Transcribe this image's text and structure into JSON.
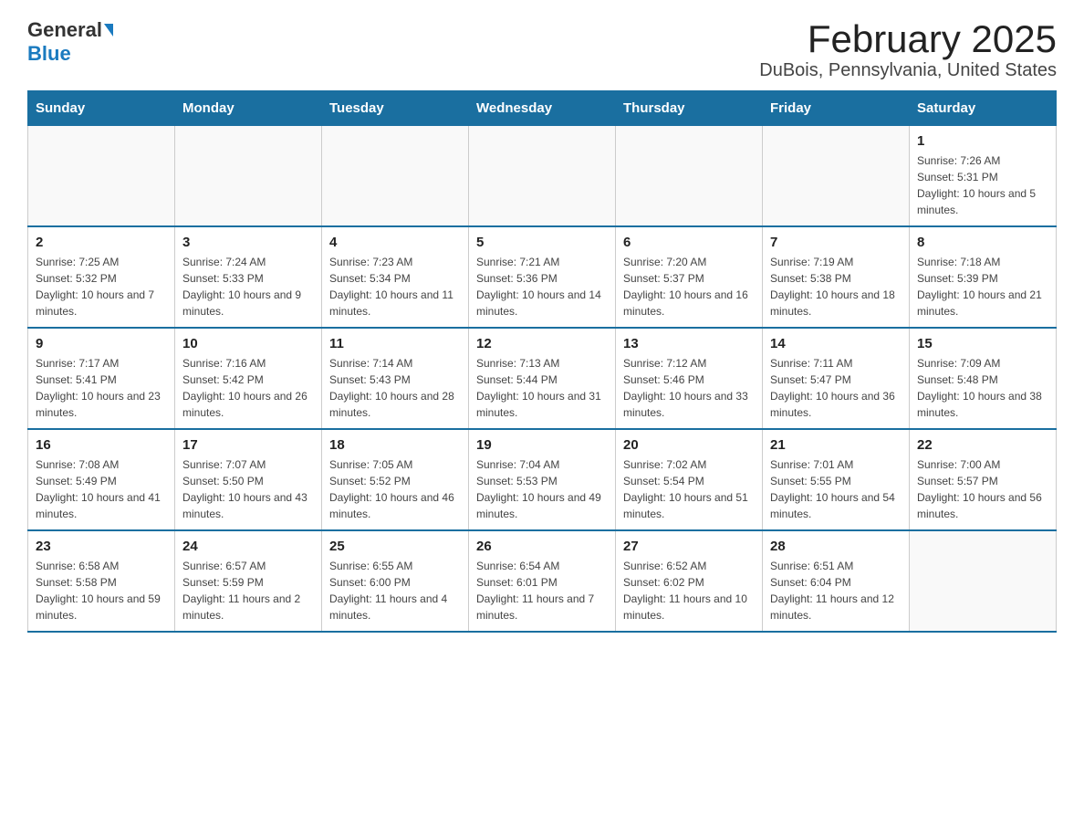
{
  "header": {
    "logo_general": "General",
    "logo_blue": "Blue",
    "title": "February 2025",
    "subtitle": "DuBois, Pennsylvania, United States"
  },
  "days_of_week": [
    "Sunday",
    "Monday",
    "Tuesday",
    "Wednesday",
    "Thursday",
    "Friday",
    "Saturday"
  ],
  "weeks": [
    [
      {
        "day": "",
        "detail": ""
      },
      {
        "day": "",
        "detail": ""
      },
      {
        "day": "",
        "detail": ""
      },
      {
        "day": "",
        "detail": ""
      },
      {
        "day": "",
        "detail": ""
      },
      {
        "day": "",
        "detail": ""
      },
      {
        "day": "1",
        "detail": "Sunrise: 7:26 AM\nSunset: 5:31 PM\nDaylight: 10 hours and 5 minutes."
      }
    ],
    [
      {
        "day": "2",
        "detail": "Sunrise: 7:25 AM\nSunset: 5:32 PM\nDaylight: 10 hours and 7 minutes."
      },
      {
        "day": "3",
        "detail": "Sunrise: 7:24 AM\nSunset: 5:33 PM\nDaylight: 10 hours and 9 minutes."
      },
      {
        "day": "4",
        "detail": "Sunrise: 7:23 AM\nSunset: 5:34 PM\nDaylight: 10 hours and 11 minutes."
      },
      {
        "day": "5",
        "detail": "Sunrise: 7:21 AM\nSunset: 5:36 PM\nDaylight: 10 hours and 14 minutes."
      },
      {
        "day": "6",
        "detail": "Sunrise: 7:20 AM\nSunset: 5:37 PM\nDaylight: 10 hours and 16 minutes."
      },
      {
        "day": "7",
        "detail": "Sunrise: 7:19 AM\nSunset: 5:38 PM\nDaylight: 10 hours and 18 minutes."
      },
      {
        "day": "8",
        "detail": "Sunrise: 7:18 AM\nSunset: 5:39 PM\nDaylight: 10 hours and 21 minutes."
      }
    ],
    [
      {
        "day": "9",
        "detail": "Sunrise: 7:17 AM\nSunset: 5:41 PM\nDaylight: 10 hours and 23 minutes."
      },
      {
        "day": "10",
        "detail": "Sunrise: 7:16 AM\nSunset: 5:42 PM\nDaylight: 10 hours and 26 minutes."
      },
      {
        "day": "11",
        "detail": "Sunrise: 7:14 AM\nSunset: 5:43 PM\nDaylight: 10 hours and 28 minutes."
      },
      {
        "day": "12",
        "detail": "Sunrise: 7:13 AM\nSunset: 5:44 PM\nDaylight: 10 hours and 31 minutes."
      },
      {
        "day": "13",
        "detail": "Sunrise: 7:12 AM\nSunset: 5:46 PM\nDaylight: 10 hours and 33 minutes."
      },
      {
        "day": "14",
        "detail": "Sunrise: 7:11 AM\nSunset: 5:47 PM\nDaylight: 10 hours and 36 minutes."
      },
      {
        "day": "15",
        "detail": "Sunrise: 7:09 AM\nSunset: 5:48 PM\nDaylight: 10 hours and 38 minutes."
      }
    ],
    [
      {
        "day": "16",
        "detail": "Sunrise: 7:08 AM\nSunset: 5:49 PM\nDaylight: 10 hours and 41 minutes."
      },
      {
        "day": "17",
        "detail": "Sunrise: 7:07 AM\nSunset: 5:50 PM\nDaylight: 10 hours and 43 minutes."
      },
      {
        "day": "18",
        "detail": "Sunrise: 7:05 AM\nSunset: 5:52 PM\nDaylight: 10 hours and 46 minutes."
      },
      {
        "day": "19",
        "detail": "Sunrise: 7:04 AM\nSunset: 5:53 PM\nDaylight: 10 hours and 49 minutes."
      },
      {
        "day": "20",
        "detail": "Sunrise: 7:02 AM\nSunset: 5:54 PM\nDaylight: 10 hours and 51 minutes."
      },
      {
        "day": "21",
        "detail": "Sunrise: 7:01 AM\nSunset: 5:55 PM\nDaylight: 10 hours and 54 minutes."
      },
      {
        "day": "22",
        "detail": "Sunrise: 7:00 AM\nSunset: 5:57 PM\nDaylight: 10 hours and 56 minutes."
      }
    ],
    [
      {
        "day": "23",
        "detail": "Sunrise: 6:58 AM\nSunset: 5:58 PM\nDaylight: 10 hours and 59 minutes."
      },
      {
        "day": "24",
        "detail": "Sunrise: 6:57 AM\nSunset: 5:59 PM\nDaylight: 11 hours and 2 minutes."
      },
      {
        "day": "25",
        "detail": "Sunrise: 6:55 AM\nSunset: 6:00 PM\nDaylight: 11 hours and 4 minutes."
      },
      {
        "day": "26",
        "detail": "Sunrise: 6:54 AM\nSunset: 6:01 PM\nDaylight: 11 hours and 7 minutes."
      },
      {
        "day": "27",
        "detail": "Sunrise: 6:52 AM\nSunset: 6:02 PM\nDaylight: 11 hours and 10 minutes."
      },
      {
        "day": "28",
        "detail": "Sunrise: 6:51 AM\nSunset: 6:04 PM\nDaylight: 11 hours and 12 minutes."
      },
      {
        "day": "",
        "detail": ""
      }
    ]
  ]
}
